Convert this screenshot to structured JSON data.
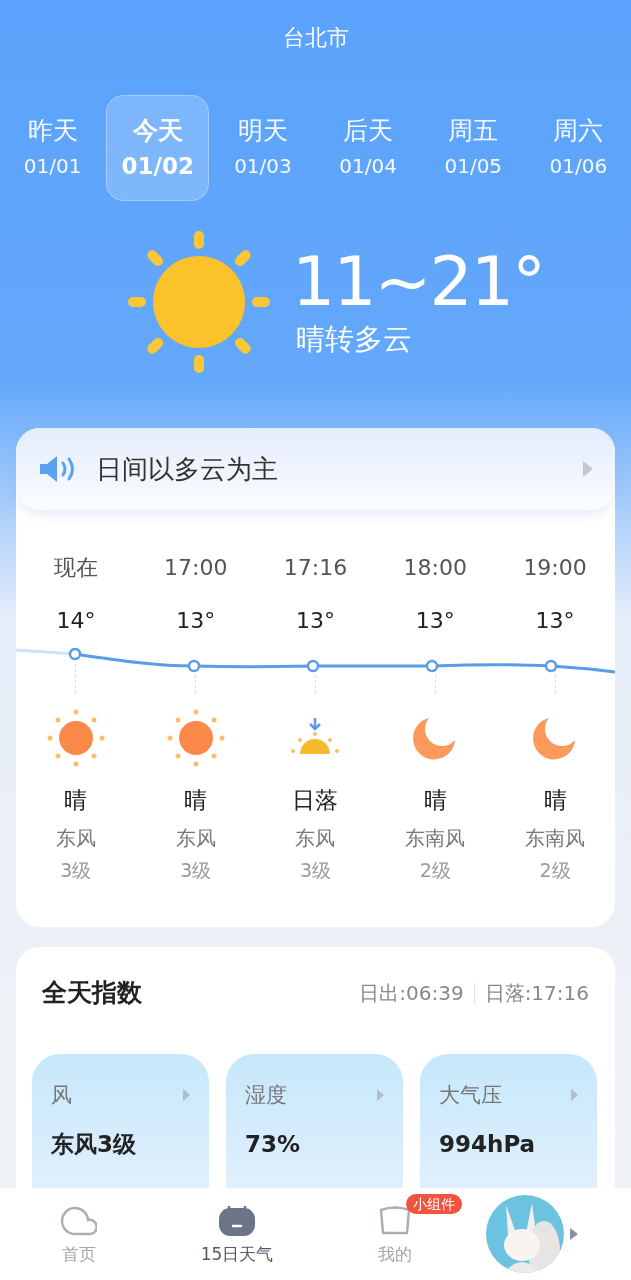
{
  "city": "台北市",
  "days": [
    {
      "label": "昨天",
      "date": "01/01",
      "selected": false
    },
    {
      "label": "今天",
      "date": "01/02",
      "selected": true
    },
    {
      "label": "明天",
      "date": "01/03",
      "selected": false
    },
    {
      "label": "后天",
      "date": "01/04",
      "selected": false
    },
    {
      "label": "周五",
      "date": "01/05",
      "selected": false
    },
    {
      "label": "周六",
      "date": "01/06",
      "selected": false
    }
  ],
  "today": {
    "range": "11~21°",
    "condition": "晴转多云"
  },
  "summary": "日间以多云为主",
  "hours": [
    {
      "time": "现在",
      "temp": "14°",
      "kind": "sun",
      "condition": "晴",
      "wind": "东风",
      "level": "3级"
    },
    {
      "time": "17:00",
      "temp": "13°",
      "kind": "sun",
      "condition": "晴",
      "wind": "东风",
      "level": "3级"
    },
    {
      "time": "17:16",
      "temp": "13°",
      "kind": "sunset",
      "condition": "日落",
      "wind": "东风",
      "level": "3级"
    },
    {
      "time": "18:00",
      "temp": "13°",
      "kind": "moon",
      "condition": "晴",
      "wind": "东南风",
      "level": "2级"
    },
    {
      "time": "19:00",
      "temp": "13°",
      "kind": "moon",
      "condition": "晴",
      "wind": "东南风",
      "level": "2级"
    }
  ],
  "indices": {
    "title": "全天指数",
    "sunrise": "日出:06:39",
    "sunset": "日落:17:16",
    "cards": [
      {
        "name": "风",
        "value": "东风3级"
      },
      {
        "name": "湿度",
        "value": "73%"
      },
      {
        "name": "大气压",
        "value": "994hPa"
      }
    ]
  },
  "nav": [
    {
      "label": "首页",
      "kind": "home",
      "selected": false
    },
    {
      "label": "15日天气",
      "kind": "calendar",
      "selected": true
    },
    {
      "label": "我的",
      "kind": "cup",
      "selected": false,
      "badge": "小组件"
    }
  ]
}
